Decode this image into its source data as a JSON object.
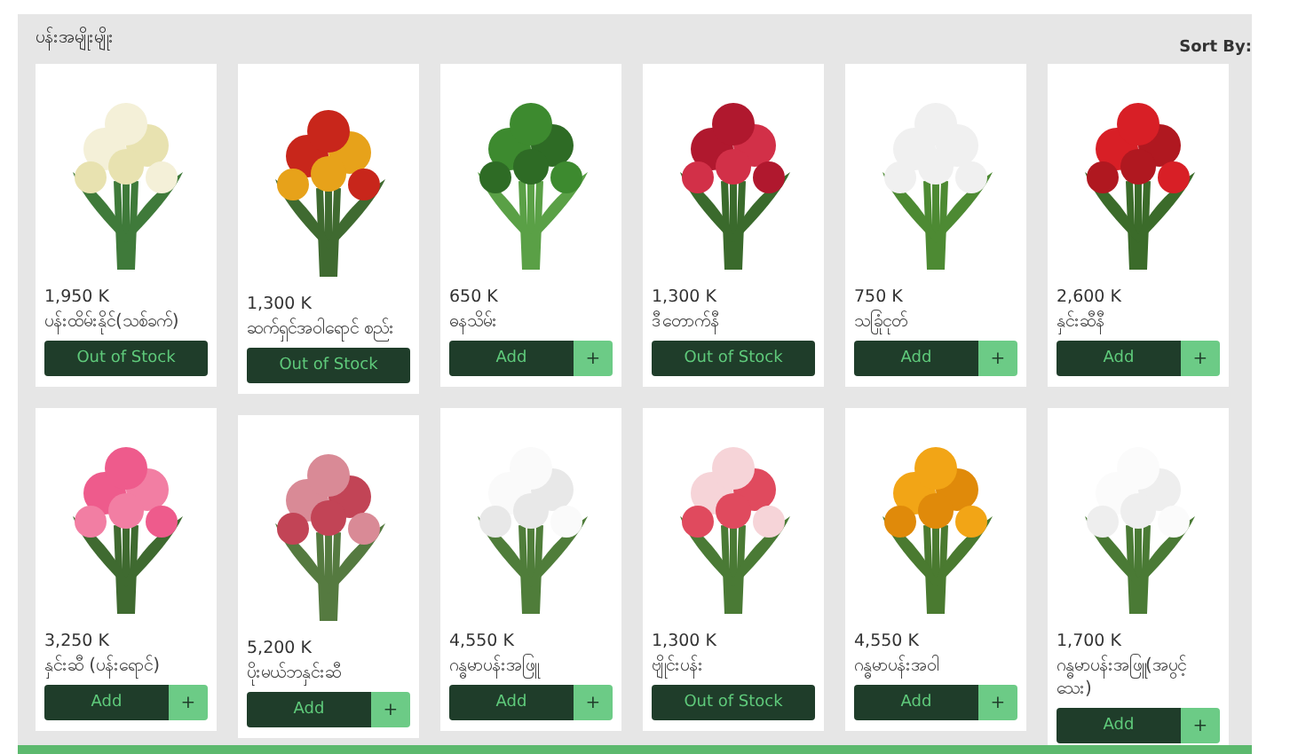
{
  "header": {
    "title": "ပန်းအမျိုးမျိုး",
    "sort_label": "Sort By:"
  },
  "columns": [
    {
      "products": [
        {
          "price": "1,950 K",
          "name": "ပန်းထိမ်းနိုင်(သစ်ခက်)",
          "button": {
            "kind": "out",
            "label": "Out of Stock"
          }
        },
        {
          "price": "3,250 K",
          "name": "နှင်းဆီ (ပန်းရောင်)",
          "button": {
            "kind": "add",
            "label": "Add",
            "plus": "+"
          }
        }
      ]
    },
    {
      "products": [
        {
          "price": "1,300 K",
          "name": "ဆက်ရှင်အဝါရောင် စည်း",
          "button": {
            "kind": "out",
            "label": "Out of Stock"
          }
        },
        {
          "price": "5,200 K",
          "name": "ပိုးမယ်ဘနှင်းဆီ",
          "button": {
            "kind": "add",
            "label": "Add",
            "plus": "+"
          }
        }
      ]
    },
    {
      "products": [
        {
          "price": "650 K",
          "name": "ဓနသိမ်း",
          "button": {
            "kind": "add",
            "label": "Add",
            "plus": "+"
          }
        },
        {
          "price": "4,550 K",
          "name": "ဂန္ဓမာပန်းအဖြူ",
          "button": {
            "kind": "add",
            "label": "Add",
            "plus": "+"
          }
        }
      ]
    },
    {
      "products": [
        {
          "price": "1,300 K",
          "name": "ဒီတောက်နီ",
          "button": {
            "kind": "out",
            "label": "Out of Stock"
          }
        },
        {
          "price": "1,300 K",
          "name": "ဗျိုင်းပန်း",
          "button": {
            "kind": "out",
            "label": "Out of Stock"
          }
        }
      ]
    },
    {
      "products": [
        {
          "price": "750 K",
          "name": "သခြုံငုတ်",
          "button": {
            "kind": "add",
            "label": "Add",
            "plus": "+"
          }
        },
        {
          "price": "4,550 K",
          "name": "ဂန္ဓမာပန်းအဝါ",
          "button": {
            "kind": "add",
            "label": "Add",
            "plus": "+"
          }
        }
      ]
    },
    {
      "products": [
        {
          "price": "2,600 K",
          "name": "နှင်းဆီနီ",
          "button": {
            "kind": "add",
            "label": "Add",
            "plus": "+"
          }
        },
        {
          "price": "1,700 K",
          "name": "ဂန္ဓမာပန်းအဖြူ(အပွင့်သေး)",
          "button": {
            "kind": "add",
            "label": "Add",
            "plus": "+"
          }
        }
      ]
    }
  ]
}
